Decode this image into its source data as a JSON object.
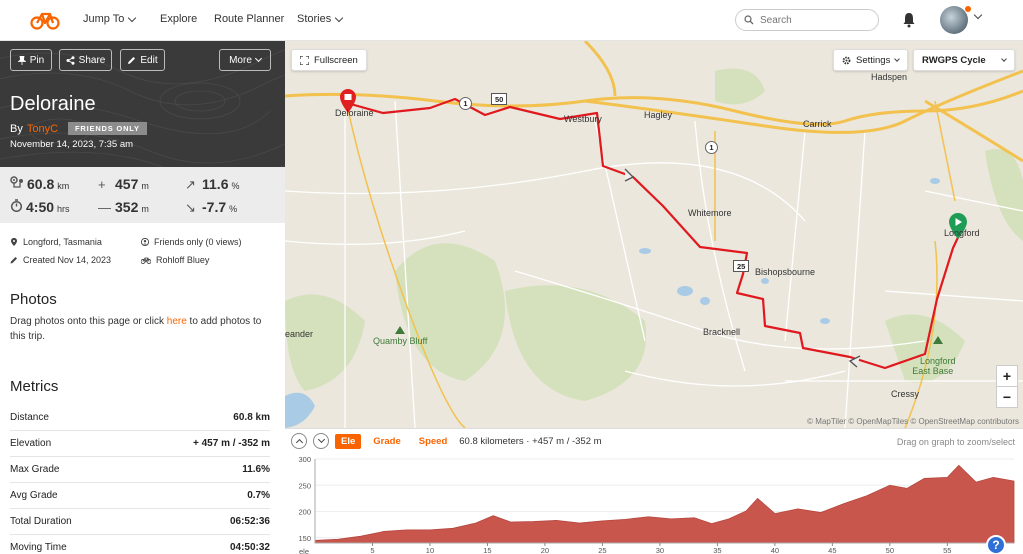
{
  "nav": {
    "items": [
      {
        "label": "Jump To",
        "has_chevron": true
      },
      {
        "label": "Explore",
        "has_chevron": false
      },
      {
        "label": "Route Planner",
        "has_chevron": false
      },
      {
        "label": "Stories",
        "has_chevron": true
      }
    ],
    "search_placeholder": "Search",
    "accent": "#fa6400"
  },
  "trip": {
    "actions": {
      "pin": "Pin",
      "share": "Share",
      "edit": "Edit",
      "more": "More"
    },
    "title": "Deloraine",
    "by": "By",
    "author": "TonyC",
    "visibility": "FRIENDS ONLY",
    "date": "November 14, 2023, 7:35 am"
  },
  "stats": {
    "distance": {
      "value": "60.8",
      "unit": "km"
    },
    "elevation_gain": {
      "value": "457",
      "unit": "m"
    },
    "max_grade": {
      "value": "11.6",
      "unit": "%"
    },
    "duration": {
      "value": "4:50",
      "unit": "hrs"
    },
    "elevation_loss": {
      "value": "352",
      "unit": "m"
    },
    "min_grade": {
      "value": "-7.7",
      "unit": "%"
    }
  },
  "meta": {
    "location": "Longford, Tasmania",
    "privacy": "Friends only (0 views)",
    "created": "Created Nov 14, 2023",
    "gear": "Rohloff Bluey"
  },
  "photos": {
    "title": "Photos",
    "text_before": "Drag photos onto this page or click ",
    "link": "here",
    "text_after": " to add photos to this trip."
  },
  "metrics": {
    "title": "Metrics",
    "rows": [
      {
        "label": "Distance",
        "value": "60.8 km"
      },
      {
        "label": "Elevation",
        "value": "+ 457 m / -352 m"
      },
      {
        "label": "Max Grade",
        "value": "11.6%"
      },
      {
        "label": "Avg Grade",
        "value": "0.7%"
      },
      {
        "label": "Total Duration",
        "value": "06:52:36"
      },
      {
        "label": "Moving Time",
        "value": "04:50:32"
      }
    ]
  },
  "map": {
    "fullscreen": "Fullscreen",
    "settings": "Settings",
    "layer": "RWGPS Cycle",
    "zoom_in": "+",
    "zoom_out": "−",
    "attribution": "© MapTiler © OpenMapTiles © OpenStreetMap contributors",
    "route_color": "#e0191e",
    "places": {
      "hadspen": "Hadspen",
      "deloraine": "Deloraine",
      "westbury": "Westbury",
      "hagley": "Hagley",
      "carrick": "Carrick",
      "whitemore": "Whitemore",
      "longford": "Longford",
      "bishopsbourne": "Bishopsbourne",
      "bracknell": "Bracknell",
      "meander": "eander",
      "quamby": "Quamby Bluff",
      "longford_east": "Longford\nEast Base",
      "cressy": "Cressy"
    },
    "shields": {
      "r50": "50",
      "r25": "25",
      "r1a": "1",
      "r1b": "1"
    }
  },
  "elevation": {
    "tabs": [
      "Ele",
      "Grade",
      "Speed"
    ],
    "active_tab": "Ele",
    "summary": "60.8 kilometers · +457 m / -352 m",
    "hint": "Drag on graph to zoom/select",
    "help": "?"
  },
  "chart_data": {
    "type": "area",
    "title": "",
    "xlabel": "",
    "ylabel": "ele",
    "xlim": [
      0,
      60.8
    ],
    "ylim": [
      140,
      300
    ],
    "x_ticks": [
      5,
      10,
      15,
      20,
      25,
      30,
      35,
      40,
      45,
      50,
      55
    ],
    "y_ticks": [
      150,
      200,
      250,
      300
    ],
    "color": "#c9564c",
    "series": [
      {
        "x": [
          0,
          2,
          4,
          6,
          8,
          10,
          12,
          14,
          15.5,
          17,
          19,
          21,
          23,
          25,
          27,
          29,
          31,
          33,
          34.5,
          36,
          37.5,
          38.5,
          40,
          42,
          44,
          46,
          48,
          50,
          51.5,
          53,
          55,
          56,
          57.5,
          59,
          60.8
        ],
        "y": [
          145,
          147,
          153,
          162,
          165,
          165,
          168,
          178,
          192,
          180,
          181,
          183,
          178,
          182,
          185,
          190,
          186,
          188,
          177,
          186,
          201,
          225,
          196,
          205,
          198,
          215,
          230,
          250,
          244,
          263,
          265,
          288,
          256,
          265,
          258
        ]
      }
    ]
  }
}
